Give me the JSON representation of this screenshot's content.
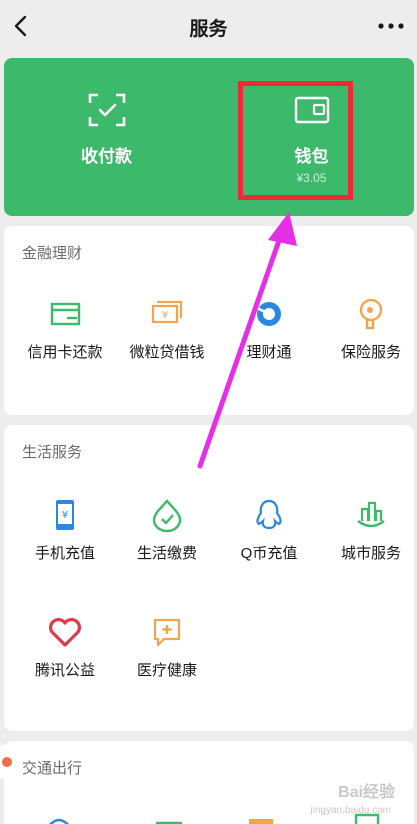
{
  "header": {
    "title": "服务",
    "back_icon": "chevron-left-icon",
    "more_icon": "more-dots-icon"
  },
  "top_actions": [
    {
      "label": "收付款",
      "icon": "scan-pay-icon"
    },
    {
      "label": "钱包",
      "sub": "¥3.05",
      "icon": "wallet-icon"
    }
  ],
  "sections": [
    {
      "title": "金融理财",
      "items": [
        {
          "label": "信用卡还款",
          "icon": "credit-card-icon"
        },
        {
          "label": "微粒贷借钱",
          "icon": "loan-icon"
        },
        {
          "label": "理财通",
          "icon": "wealth-icon"
        },
        {
          "label": "保险服务",
          "icon": "insurance-icon"
        }
      ]
    },
    {
      "title": "生活服务",
      "items": [
        {
          "label": "手机充值",
          "icon": "phone-topup-icon"
        },
        {
          "label": "生活缴费",
          "icon": "utility-bill-icon"
        },
        {
          "label": "Q币充值",
          "icon": "qcoin-icon"
        },
        {
          "label": "城市服务",
          "icon": "city-service-icon"
        },
        {
          "label": "腾讯公益",
          "icon": "charity-icon"
        },
        {
          "label": "医疗健康",
          "icon": "medical-icon"
        }
      ]
    },
    {
      "title": "交通出行"
    }
  ],
  "watermark": {
    "text": "Bai经验",
    "sub": "jingyan.baidu.com"
  },
  "colors": {
    "green": "#3cb96a",
    "highlight_red": "#ec2b37",
    "arrow_magenta": "#e62ee6"
  }
}
